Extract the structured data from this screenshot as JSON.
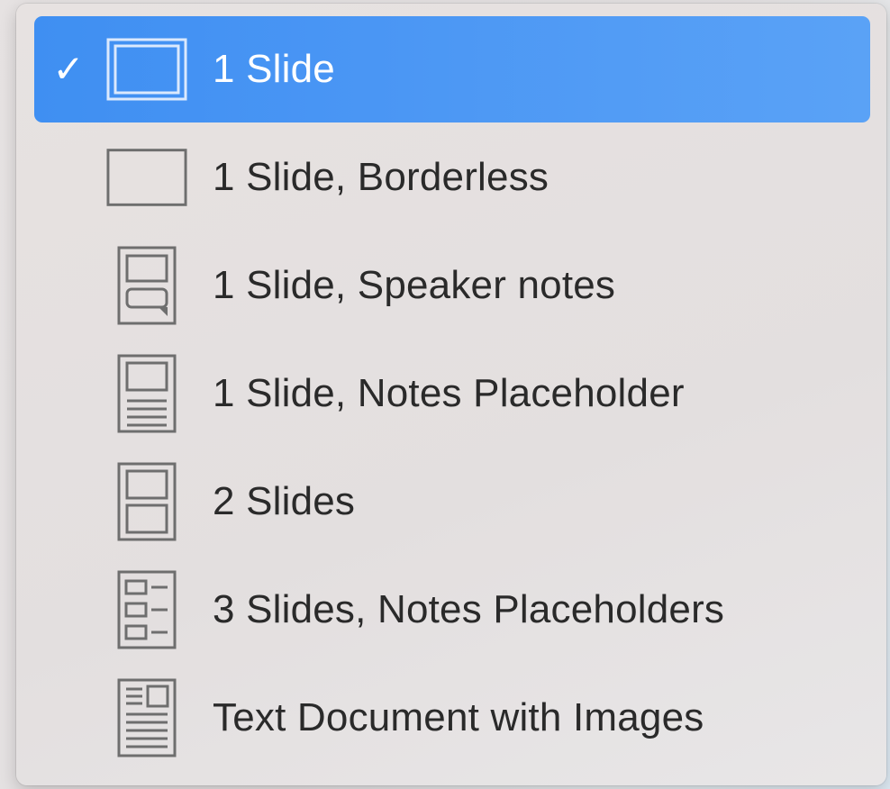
{
  "menu": {
    "selected_index": 0,
    "check_glyph": "✓",
    "items": [
      {
        "label": "1 Slide",
        "icon": "slide-framed-icon",
        "selected": true
      },
      {
        "label": "1 Slide, Borderless",
        "icon": "slide-borderless-icon",
        "selected": false
      },
      {
        "label": "1 Slide, Speaker notes",
        "icon": "speaker-notes-icon",
        "selected": false
      },
      {
        "label": "1 Slide, Notes Placeholder",
        "icon": "notes-placeholder-icon",
        "selected": false
      },
      {
        "label": "2 Slides",
        "icon": "two-slides-icon",
        "selected": false
      },
      {
        "label": "3 Slides, Notes Placeholders",
        "icon": "three-slides-notes-icon",
        "selected": false
      },
      {
        "label": "Text Document with Images",
        "icon": "text-document-images-icon",
        "selected": false
      }
    ]
  },
  "colors": {
    "selection": "#4a96f4",
    "text": "#2a2a2a",
    "icon_stroke": "#6e6e6e",
    "icon_stroke_selected": "#dbe9fd"
  }
}
